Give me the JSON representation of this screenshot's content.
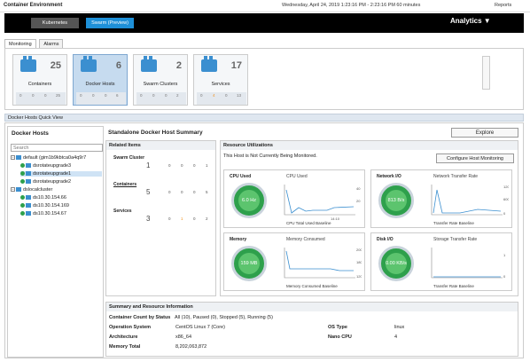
{
  "topbar": {
    "title": "Container Environment",
    "datetime": "Wednesday, April 24, 2019 1:23:16 PM - 2:23:16 PM 60 minutes",
    "reports": "Reports"
  },
  "nav": {
    "kubernetes": "Kubernetes",
    "swarm": "Swarm (Preview)",
    "analytics": "Analytics"
  },
  "tabs": [
    "Monitoring",
    "Alarms"
  ],
  "tiles": [
    {
      "label": "Containers",
      "count": "25",
      "status": [
        "0",
        "0",
        "0",
        "25"
      ]
    },
    {
      "label": "Docker Hosts",
      "count": "6",
      "status": [
        "0",
        "0",
        "0",
        "6"
      ]
    },
    {
      "label": "Swarm Clusters",
      "count": "2",
      "status": [
        "0",
        "0",
        "0",
        "2"
      ]
    },
    {
      "label": "Services",
      "count": "17",
      "status": [
        "0",
        "4",
        "0",
        "13"
      ]
    }
  ],
  "quickview_title": "Docker Hosts Quick View",
  "docker_hosts": {
    "title": "Docker Hosts",
    "search_placeholder": "Search",
    "tree": [
      {
        "text": "default (gim1b9kbtca0a4q9r7"
      },
      {
        "text": "dsrotateupgrade3"
      },
      {
        "text": "dsrotateupgrade1"
      },
      {
        "text": "dsrotateupgrade2"
      },
      {
        "text": "dslocalcluster"
      },
      {
        "text": "ds10.30.154.66"
      },
      {
        "text": "ds10.30.154.169"
      },
      {
        "text": "ds10.30.154.67"
      }
    ]
  },
  "summary_title": "Standalone Docker Host Summary",
  "explore": "Explore",
  "related": {
    "title": "Related Items",
    "rows": [
      {
        "name": "Swarm Cluster",
        "num": "1",
        "stats": [
          "0",
          "0",
          "0",
          "1"
        ]
      },
      {
        "name": "Containers",
        "num": "5",
        "stats": [
          "0",
          "0",
          "0",
          "5"
        ]
      },
      {
        "name": "Services",
        "num": "3",
        "stats": [
          "0",
          "1",
          "0",
          "2"
        ]
      }
    ]
  },
  "resource": {
    "title": "Resource Utilizations",
    "not_monitored": "This Host is Not Currently Being Monitored.",
    "configure": "Configure Host Monitoring",
    "cards": [
      {
        "title": "CPU Used",
        "value": "6.0 Hz",
        "chart_title": "CPU Used",
        "legend": "CPU Total Used  Baseline",
        "yticks": [
          "40",
          "20"
        ],
        "xticks": [
          "13:30",
          "13:50",
          "14:10"
        ]
      },
      {
        "title": "Network I/O",
        "value": "813 B/s",
        "chart_title": "Network Transfer Rate",
        "legend": "Transfer Rate  Baseline",
        "yticks": [
          "1200",
          "600",
          "0"
        ],
        "xticks": [
          "13:30",
          "13:50",
          "14:10"
        ]
      },
      {
        "title": "Memory",
        "value": "159 MB",
        "chart_title": "Memory Consumed",
        "legend": "Memory Consumed  Baseline",
        "yticks": [
          "200",
          "180",
          "120"
        ],
        "xticks": [
          "13:30",
          "13:50",
          "14:10"
        ]
      },
      {
        "title": "Disk I/O",
        "value": "0.00 KB/s",
        "chart_title": "Storage Transfer Rate",
        "legend": "Transfer Rate  Baseline",
        "yticks": [
          "1",
          "0"
        ],
        "xticks": [
          "13:30",
          "13:50",
          "14:10"
        ]
      }
    ]
  },
  "summary": {
    "title": "Summary and Resource Information",
    "container_count_label": "Container Count by Status",
    "container_count_value": "All (10), Paused (0), Stopped (5), Running (5)",
    "os_label": "Operation System",
    "os_value": "CentOS Linux 7 (Core)",
    "ostype_label": "OS Type",
    "ostype_value": "linux",
    "arch_label": "Architecture",
    "arch_value": "x86_64",
    "nanocpu_label": "Nano CPU",
    "nanocpu_value": "4",
    "mem_label": "Memory Total",
    "mem_value": "8,202,063,872"
  },
  "colors": {
    "accent": "#1e90d8",
    "ok": "#2ea04c",
    "warn": "#f29420"
  }
}
